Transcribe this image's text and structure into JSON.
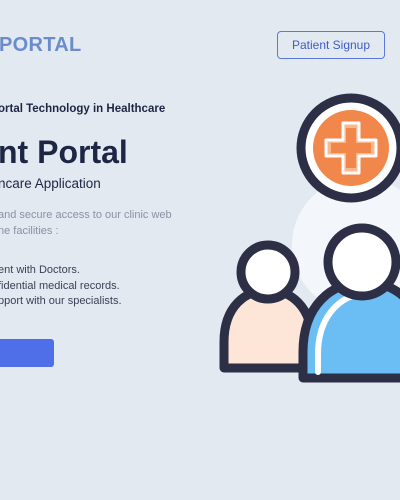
{
  "header": {
    "brand": "PORTAL",
    "signup_label": "Patient Signup"
  },
  "hero": {
    "tagline": "ortal Technology in Healthcare",
    "title": "nt Portal",
    "subtitle": "ncare Application",
    "description_lines": [
      "and secure access to our clinic web",
      "ne facilities :"
    ],
    "features": [
      "ent with Doctors.",
      "fidential medical records.",
      "pport with our specialists."
    ],
    "cta_label": ""
  },
  "illustration": {
    "colors": {
      "outline": "#2c2f45",
      "plus_badge": "#f1874a",
      "plus_highlight": "#fbb88d",
      "person_back": "#fde6d8",
      "person_front": "#6bbef4",
      "person_front_shadow": "#54a4e0",
      "backdrop": "#f3f6fa"
    },
    "icons": [
      "medical-plus-icon",
      "patient-icon",
      "doctor-icon"
    ]
  }
}
